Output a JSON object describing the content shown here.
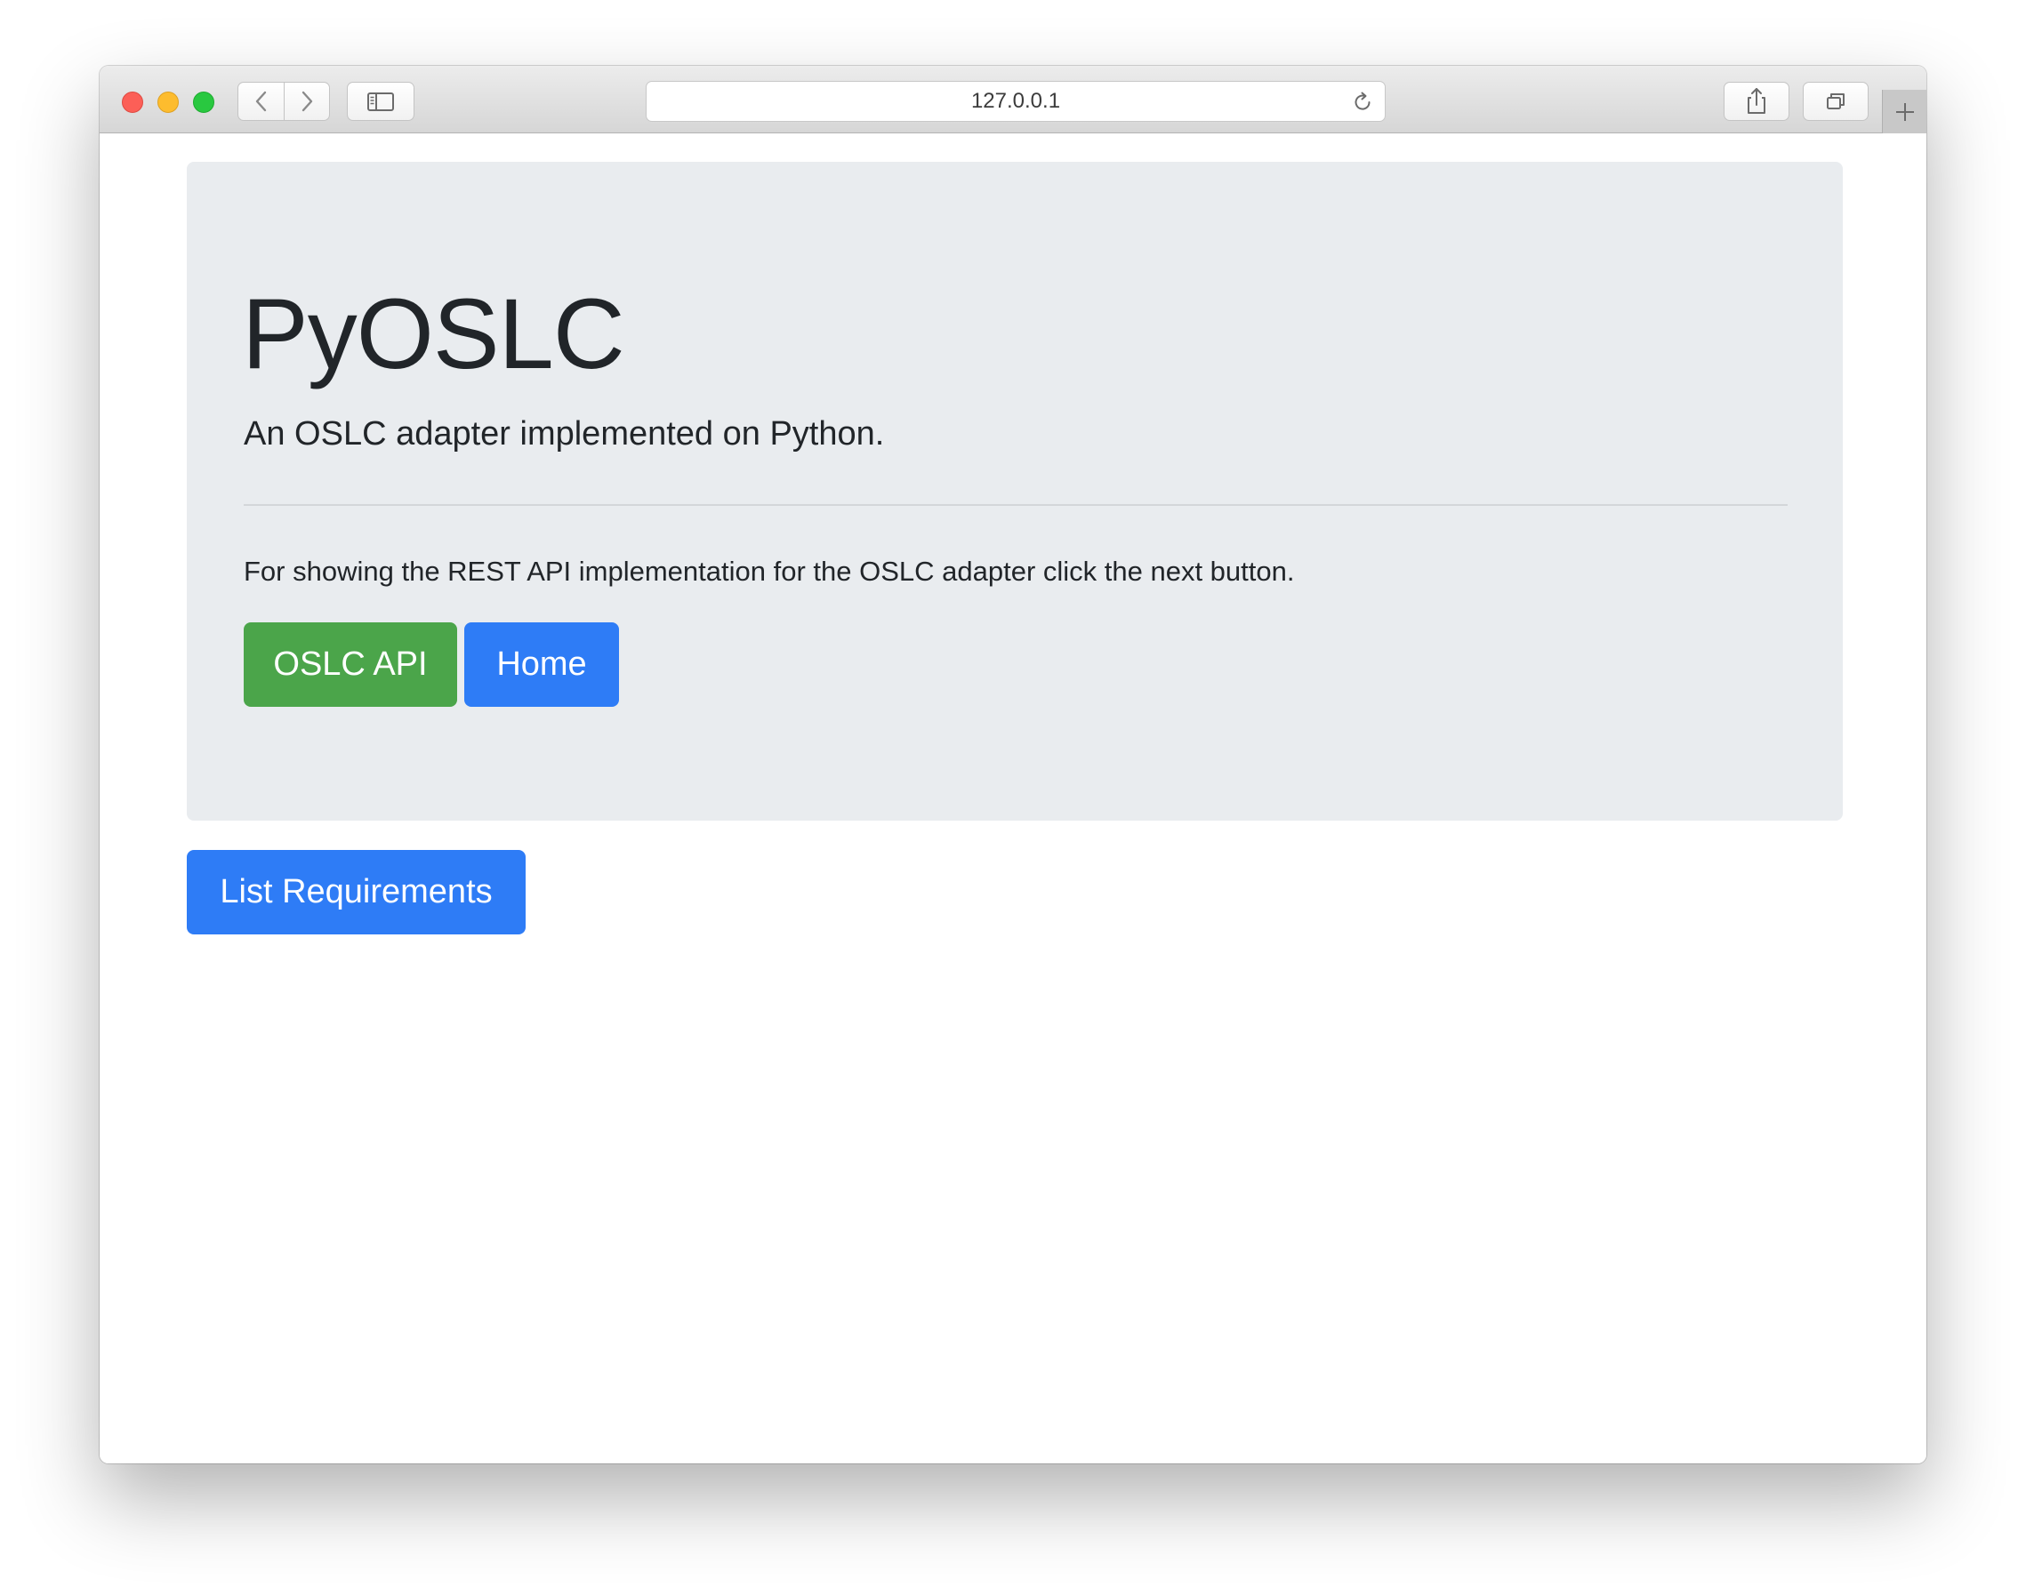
{
  "browser": {
    "address": "127.0.0.1"
  },
  "jumbotron": {
    "title": "PyOSLC",
    "subtitle": "An OSLC adapter implemented on Python.",
    "description": "For showing the REST API implementation for the OSLC adapter click the next button.",
    "oslc_api_label": "OSLC API",
    "home_label": "Home"
  },
  "main": {
    "list_requirements_label": "List Requirements"
  },
  "colors": {
    "success": "#4ba54a",
    "primary": "#2e7cf6",
    "jumbotron_bg": "#e9ecef"
  }
}
